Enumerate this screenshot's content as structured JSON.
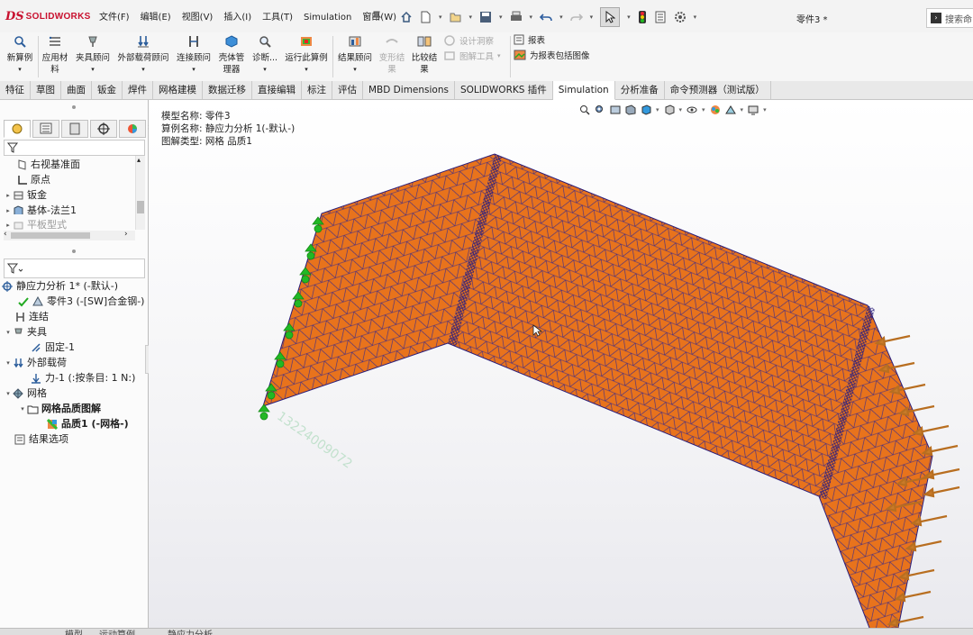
{
  "app": {
    "brand_ds": "DS",
    "brand_name": "SOLIDWORKS",
    "doc_title": "零件3 *"
  },
  "menu": [
    "文件(F)",
    "编辑(E)",
    "视图(V)",
    "插入(I)",
    "工具(T)",
    "Simulation",
    "窗口(W)"
  ],
  "search": {
    "placeholder": "搜索命"
  },
  "commands": {
    "new_study": "新算例",
    "apply_material_1": "应用材",
    "apply_material_2": "料",
    "fixtures": "夹具顾问",
    "external_loads": "外部载荷顾问",
    "connections": "连接顾问",
    "shell_manager_1": "壳体管",
    "shell_manager_2": "理器",
    "diagnose": "诊断...",
    "run": "运行此算例",
    "results_advisor": "结果顾问",
    "deformed_1": "变形结",
    "deformed_2": "果",
    "compare_1": "比较结",
    "compare_2": "果",
    "design_insight": "设计洞察",
    "plot_tools": "图解工具",
    "report": "报表",
    "include_image": "为报表包括图像"
  },
  "tabs": [
    "特征",
    "草图",
    "曲面",
    "钣金",
    "焊件",
    "网格建模",
    "数据迁移",
    "直接编辑",
    "标注",
    "评估",
    "MBD Dimensions",
    "SOLIDWORKS 插件",
    "Simulation",
    "分析准备",
    "命令预测器（测试版）"
  ],
  "active_tab": "Simulation",
  "feature_tree": {
    "items": [
      "右视基准面",
      "原点",
      "钣金",
      "基体-法兰1",
      "平板型式"
    ]
  },
  "study_tree": {
    "study": "静应力分析 1* (-默认-)",
    "part": "零件3 (-[SW]合金钢-)",
    "connections": "连结",
    "fixtures": "夹具",
    "fixed": "固定-1",
    "external_loads": "外部载荷",
    "force": "力-1 (:按条目: 1 N:)",
    "mesh": "网格",
    "mesh_quality_plot": "网格品质图解",
    "quality": "品质1 (-网格-)",
    "result_options": "结果选项"
  },
  "viewport": {
    "model_name": "模型名称: 零件3",
    "study_name": "算例名称: 静应力分析 1(-默认-)",
    "plot_type": "图解类型: 网格 品质1",
    "watermark": "13224009072"
  },
  "bottom_tabs": [
    "模型",
    "运动算例",
    "静应力分析"
  ],
  "colors": {
    "mesh_fill": "#e8731c",
    "mesh_line": "#3a2a8a",
    "fixture": "#22b824",
    "load_arrow": "#c87a28",
    "accent": "#c8102e"
  }
}
